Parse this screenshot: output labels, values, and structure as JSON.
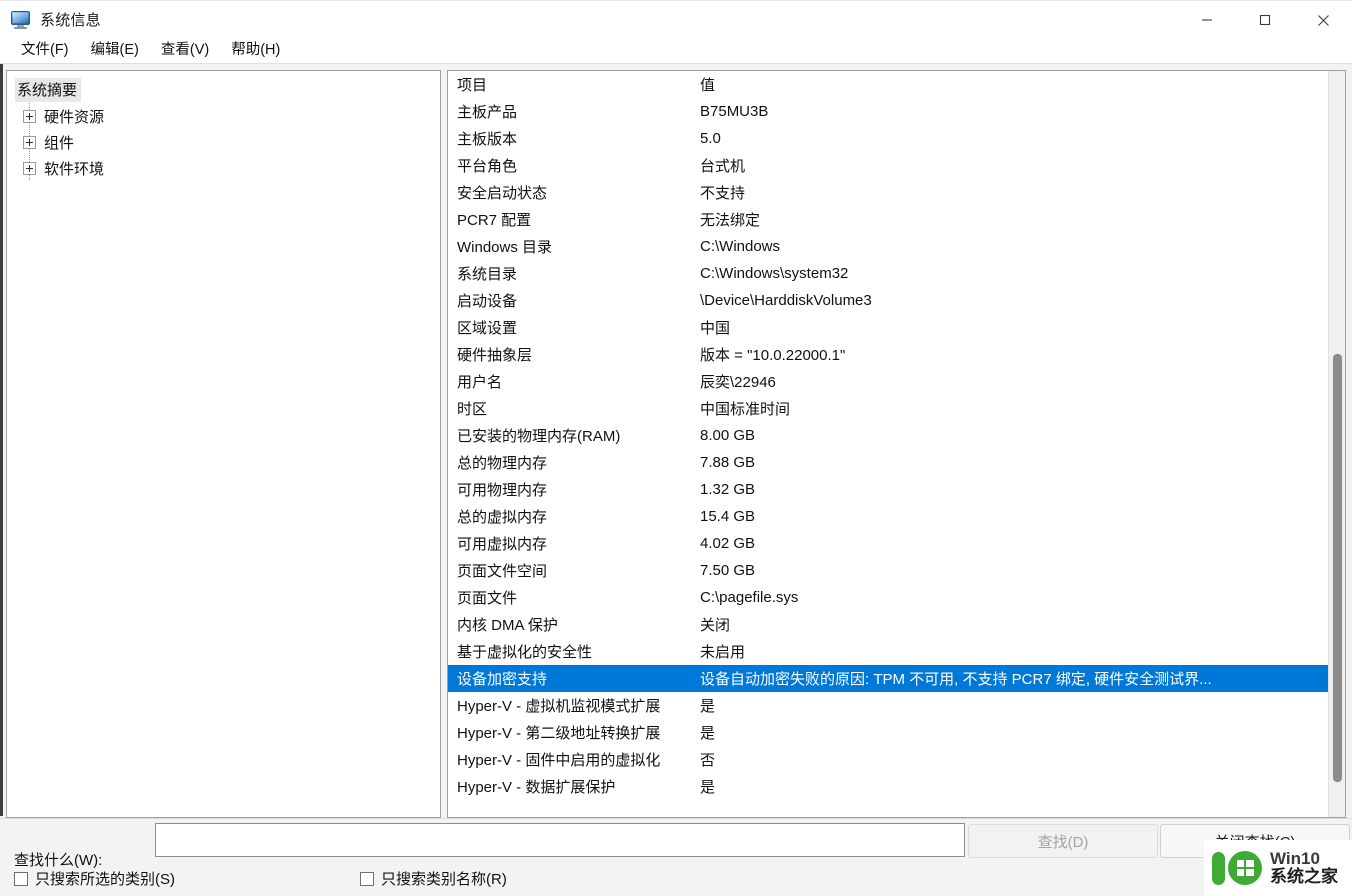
{
  "window": {
    "title": "系统信息",
    "icon": "monitor-icon",
    "controls": {
      "minimize": "minimize-icon",
      "maximize": "maximize-icon",
      "close": "close-icon"
    }
  },
  "menubar": {
    "items": [
      {
        "label": "文件(F)",
        "name": "menu-file"
      },
      {
        "label": "编辑(E)",
        "name": "menu-edit"
      },
      {
        "label": "查看(V)",
        "name": "menu-view"
      },
      {
        "label": "帮助(H)",
        "name": "menu-help"
      }
    ]
  },
  "tree": {
    "root": {
      "label": "系统摘要",
      "selected": true
    },
    "children": [
      {
        "label": "硬件资源",
        "expanded": false
      },
      {
        "label": "组件",
        "expanded": false
      },
      {
        "label": "软件环境",
        "expanded": false
      }
    ]
  },
  "table": {
    "columns": {
      "item": "项目",
      "value": "值"
    },
    "selected_index": 21,
    "rows": [
      {
        "item": "主板产品",
        "value": "B75MU3B"
      },
      {
        "item": "主板版本",
        "value": "5.0"
      },
      {
        "item": "平台角色",
        "value": "台式机"
      },
      {
        "item": "安全启动状态",
        "value": "不支持"
      },
      {
        "item": "PCR7 配置",
        "value": "无法绑定"
      },
      {
        "item": "Windows 目录",
        "value": "C:\\Windows"
      },
      {
        "item": "系统目录",
        "value": "C:\\Windows\\system32"
      },
      {
        "item": "启动设备",
        "value": "\\Device\\HarddiskVolume3"
      },
      {
        "item": "区域设置",
        "value": "中国"
      },
      {
        "item": "硬件抽象层",
        "value": "版本 = \"10.0.22000.1\""
      },
      {
        "item": "用户名",
        "value": "辰奕\\22946"
      },
      {
        "item": "时区",
        "value": "中国标准时间"
      },
      {
        "item": "已安装的物理内存(RAM)",
        "value": "8.00 GB"
      },
      {
        "item": "总的物理内存",
        "value": "7.88 GB"
      },
      {
        "item": "可用物理内存",
        "value": "1.32 GB"
      },
      {
        "item": "总的虚拟内存",
        "value": "15.4 GB"
      },
      {
        "item": "可用虚拟内存",
        "value": "4.02 GB"
      },
      {
        "item": "页面文件空间",
        "value": "7.50 GB"
      },
      {
        "item": "页面文件",
        "value": "C:\\pagefile.sys"
      },
      {
        "item": "内核 DMA 保护",
        "value": "关闭"
      },
      {
        "item": "基于虚拟化的安全性",
        "value": "未启用"
      },
      {
        "item": "设备加密支持",
        "value": "设备自动加密失败的原因: TPM 不可用, 不支持 PCR7 绑定, 硬件安全测试界..."
      },
      {
        "item": "Hyper-V - 虚拟机监视模式扩展",
        "value": "是"
      },
      {
        "item": "Hyper-V - 第二级地址转换扩展",
        "value": "是"
      },
      {
        "item": "Hyper-V - 固件中启用的虚拟化",
        "value": "否"
      },
      {
        "item": "Hyper-V - 数据扩展保护",
        "value": "是"
      }
    ]
  },
  "find": {
    "label": "查找什么(W):",
    "input_value": "",
    "input_placeholder": "",
    "checkbox_selected_category": {
      "label": "只搜索所选的类别(S)",
      "checked": false
    },
    "checkbox_category_name_only": {
      "label": "只搜索类别名称(R)",
      "checked": false
    },
    "find_button": {
      "label": "查找(D)",
      "disabled": true
    },
    "close_find_button": {
      "label": "关闭查找(C)",
      "disabled": false
    }
  },
  "watermark": {
    "line1": "Win10",
    "line2": "系统之家"
  },
  "colors": {
    "selection_blue": "#0078d7",
    "tree_selection_gray": "#e8e8e8",
    "watermark_green": "#3faa35",
    "window_bg": "#f3f3f3"
  }
}
